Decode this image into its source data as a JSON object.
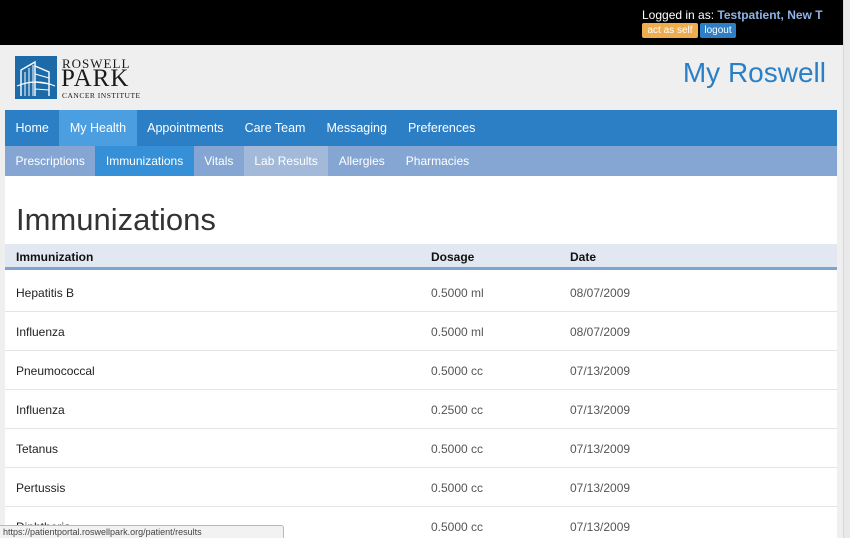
{
  "topbar": {
    "logged_in_label": "Logged in as:",
    "user_name": "Testpatient, New T",
    "act_as_self_label": "act as self",
    "logout_label": "logout"
  },
  "header": {
    "logo_line1": "ROSWELL",
    "logo_line2": "PARK",
    "logo_line3": "CANCER INSTITUTE",
    "brand_title": "My Roswell"
  },
  "nav_primary": [
    {
      "label": "Home",
      "active": false
    },
    {
      "label": "My Health",
      "active": true
    },
    {
      "label": "Appointments",
      "active": false
    },
    {
      "label": "Care Team",
      "active": false
    },
    {
      "label": "Messaging",
      "active": false
    },
    {
      "label": "Preferences",
      "active": false
    }
  ],
  "nav_secondary": [
    {
      "label": "Prescriptions",
      "active": false
    },
    {
      "label": "Immunizations",
      "active": true
    },
    {
      "label": "Vitals",
      "active": false
    },
    {
      "label": "Lab Results",
      "active": false,
      "hover": true
    },
    {
      "label": "Allergies",
      "active": false
    },
    {
      "label": "Pharmacies",
      "active": false
    }
  ],
  "page": {
    "title": "Immunizations",
    "columns": [
      "Immunization",
      "Dosage",
      "Date"
    ],
    "rows": [
      {
        "name": "Hepatitis B",
        "dosage": "0.5000 ml",
        "date": "08/07/2009"
      },
      {
        "name": "Influenza",
        "dosage": "0.5000 ml",
        "date": "08/07/2009"
      },
      {
        "name": "Pneumococcal",
        "dosage": "0.5000 cc",
        "date": "07/13/2009"
      },
      {
        "name": "Influenza",
        "dosage": "0.2500 cc",
        "date": "07/13/2009"
      },
      {
        "name": "Tetanus",
        "dosage": "0.5000 cc",
        "date": "07/13/2009"
      },
      {
        "name": "Pertussis",
        "dosage": "0.5000 cc",
        "date": "07/13/2009"
      },
      {
        "name": "Diphtheria",
        "dosage": "0.5000 cc",
        "date": "07/13/2009"
      }
    ]
  },
  "statusbar": {
    "url": "https://patientportal.roswellpark.org/patient/results"
  },
  "colors": {
    "nav_primary": "#2c7ec5",
    "nav_primary_active": "#4b9ee0",
    "nav_secondary": "#85a6d3",
    "nav_secondary_active": "#3590d7",
    "brand": "#2a80c6",
    "act_as_self": "#f0ad4e",
    "logout": "#2e7fc4"
  }
}
